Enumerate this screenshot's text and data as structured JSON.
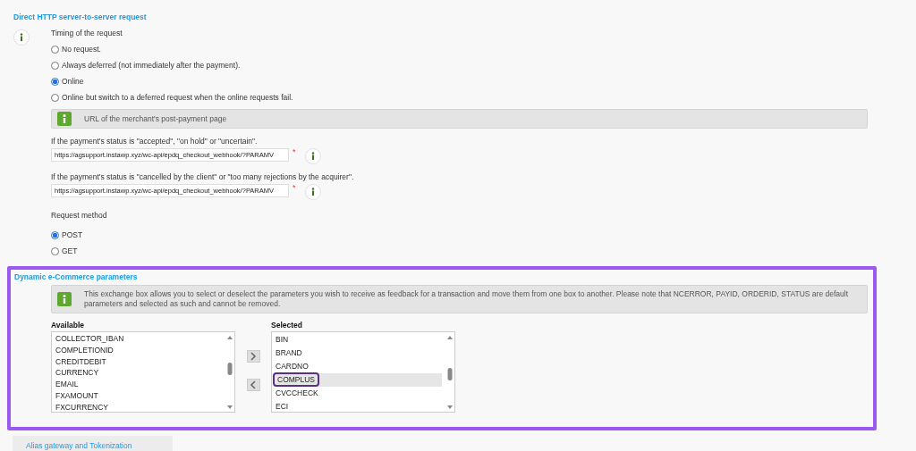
{
  "server_request": {
    "title": "Direct HTTP server-to-server request",
    "timing_label": "Timing of the request",
    "timing_options": [
      {
        "label": "No request.",
        "selected": false
      },
      {
        "label": "Always deferred (not immediately after the payment).",
        "selected": false
      },
      {
        "label": "Online",
        "selected": true
      },
      {
        "label": "Online but switch to a deferred request when the online requests fail.",
        "selected": false
      }
    ],
    "info_bar": "URL of the merchant's post-payment page",
    "url_fields": [
      {
        "label": "If the payment's status is \"accepted\", \"on hold\" or \"uncertain\".",
        "value": "https://agsupport.instawp.xyz/wc-api/epdq_checkout_webhook/?PARAMV",
        "required_mark": "*"
      },
      {
        "label": "If the payment's status is \"cancelled by the client\" or \"too many rejections by the acquirer\".",
        "value": "https://agsupport.instawp.xyz/wc-api/epdq_checkout_webhook/?PARAMV",
        "required_mark": "*"
      }
    ],
    "method_label": "Request method",
    "method_options": [
      {
        "label": "POST",
        "selected": true
      },
      {
        "label": "GET",
        "selected": false
      }
    ]
  },
  "ecommerce_parameters": {
    "title": "Dynamic e-Commerce parameters",
    "info_text": "This exchange box allows you to select or deselect the parameters you wish to receive as feedback for a transaction and move them from one box to another. Please note that NCERROR, PAYID, ORDERID, STATUS are default parameters and selected as such and cannot be removed.",
    "available": {
      "label": "Available",
      "items": [
        {
          "label": "COLLECTOR_IBAN",
          "selected": false
        },
        {
          "label": "COMPLETIONID",
          "selected": false
        },
        {
          "label": "CREDITDEBIT",
          "selected": false
        },
        {
          "label": "CURRENCY",
          "selected": false
        },
        {
          "label": "EMAIL",
          "selected": false
        },
        {
          "label": "FXAMOUNT",
          "selected": false
        },
        {
          "label": "FXCURRENCY",
          "selected": false
        }
      ]
    },
    "selected": {
      "label": "Selected",
      "items": [
        {
          "label": "BIN",
          "selected": false
        },
        {
          "label": "BRAND",
          "selected": false
        },
        {
          "label": "CARDNO",
          "selected": false
        },
        {
          "label": "COMPLUS",
          "selected": true
        },
        {
          "label": "CVCCHECK",
          "selected": false
        },
        {
          "label": "ECI",
          "selected": false
        }
      ]
    }
  },
  "tabs": [
    {
      "label": "Alias gateway and Tokenization"
    }
  ]
}
